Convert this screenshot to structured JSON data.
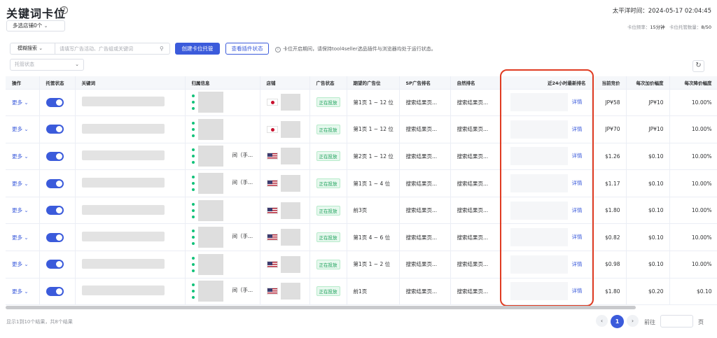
{
  "page": {
    "title": "关键词卡位",
    "help_icon": "question-circle-icon",
    "timezone": "太平洋时间：2024-05-17 02:04:45",
    "shop_select": "多选店铺0个",
    "freq_label": "卡位频率：",
    "freq_value": "15分钟",
    "quota_label": "卡位托管数量：",
    "quota_value": "8/50"
  },
  "toolbar": {
    "search_mode": "模糊搜索",
    "search_placeholder": "请填写广告活动、广告组或关键词",
    "create_button": "创建卡位托管",
    "plugin_button": "查看插件状态",
    "info_text": "卡位开启期间，请保持tool4seller选品插件与浏览器均处于运行状态。",
    "status_placeholder": "托管状态"
  },
  "table": {
    "headers": [
      "操作",
      "托管状态",
      "关键词",
      "归属信息",
      "店铺",
      "广告状态",
      "期望的广告位",
      "SP广告排名",
      "自然排名",
      "近24小时最新排名",
      "当前竞价",
      "每次加价幅度",
      "每次降价幅度"
    ],
    "rows": [
      {
        "action": "更多",
        "owner": "",
        "flag": "jp",
        "ad_status": "正在投放",
        "expected": "第1页 1 ~ 12 位",
        "sp_rank": "搜索结果页...",
        "organic": "搜索结果页...",
        "detail": "详情",
        "bid": "JP¥58",
        "inc": "JP¥10",
        "dec": "10.00%"
      },
      {
        "action": "更多",
        "owner": "",
        "flag": "jp",
        "ad_status": "正在投放",
        "expected": "第1页 1 ~ 12 位",
        "sp_rank": "搜索结果页...",
        "organic": "搜索结果页...",
        "detail": "详情",
        "bid": "JP¥70",
        "inc": "JP¥10",
        "dec": "10.00%"
      },
      {
        "action": "更多",
        "owner": "间（手...",
        "flag": "us",
        "ad_status": "正在投放",
        "expected": "第2页 1 ~ 12 位",
        "sp_rank": "搜索结果页...",
        "organic": "搜索结果页...",
        "detail": "详情",
        "bid": "$1.26",
        "inc": "$0.10",
        "dec": "10.00%"
      },
      {
        "action": "更多",
        "owner": "间（手...",
        "flag": "us",
        "ad_status": "正在投放",
        "expected": "第1页 1 ~ 4 位",
        "sp_rank": "搜索结果页...",
        "organic": "搜索结果页...",
        "detail": "详情",
        "bid": "$1.17",
        "inc": "$0.10",
        "dec": "10.00%"
      },
      {
        "action": "更多",
        "owner": "",
        "flag": "us",
        "ad_status": "正在投放",
        "expected": "前3页",
        "sp_rank": "搜索结果页...",
        "organic": "搜索结果页...",
        "detail": "详情",
        "bid": "$1.80",
        "inc": "$0.10",
        "dec": "10.00%"
      },
      {
        "action": "更多",
        "owner": "间（手...",
        "flag": "us",
        "ad_status": "正在投放",
        "expected": "第1页 4 ~ 6 位",
        "sp_rank": "搜索结果页...",
        "organic": "搜索结果页...",
        "detail": "详情",
        "bid": "$0.82",
        "inc": "$0.10",
        "dec": "10.00%"
      },
      {
        "action": "更多",
        "owner": "",
        "flag": "us",
        "ad_status": "正在投放",
        "expected": "第1页 1 ~ 2 位",
        "sp_rank": "搜索结果页...",
        "organic": "搜索结果页...",
        "detail": "详情",
        "bid": "$0.98",
        "inc": "$0.10",
        "dec": "10.00%"
      },
      {
        "action": "更多",
        "owner": "间（手...",
        "flag": "us",
        "ad_status": "正在投放",
        "expected": "前1页",
        "sp_rank": "搜索结果页...",
        "organic": "搜索结果页...",
        "detail": "详情",
        "bid": "$1.80",
        "inc": "$0.20",
        "dec": "$0.10"
      }
    ]
  },
  "pagination": {
    "summary": "显示1到10个结果，共8个结果",
    "current": "1",
    "goto_label": "前往",
    "page_label": "页"
  },
  "colors": {
    "accent": "#3b5bdb",
    "highlight": "#e03c22",
    "status_green": "#18a058"
  }
}
